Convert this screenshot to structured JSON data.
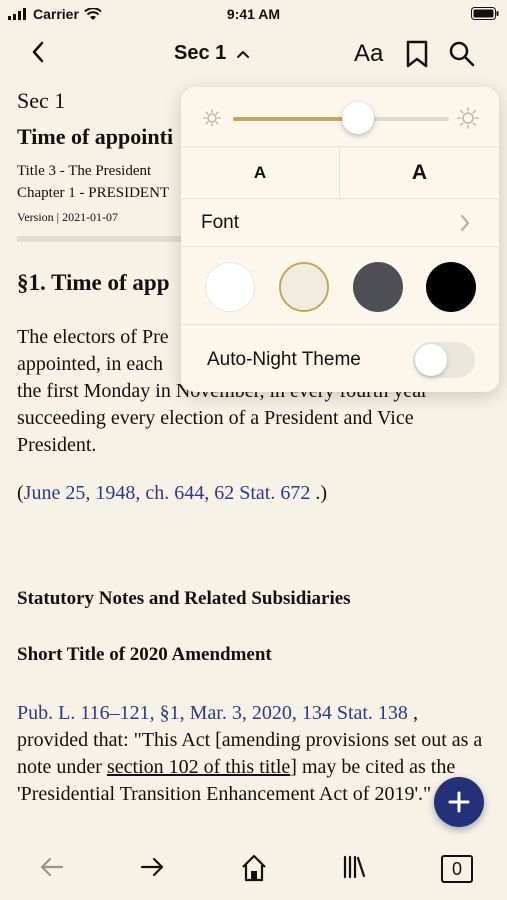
{
  "status_bar": {
    "carrier": "Carrier",
    "time": "9:41 AM"
  },
  "nav": {
    "section": "Sec 1",
    "text_size_label": "Aa"
  },
  "document": {
    "sec_label": "Sec 1",
    "title": "Time of appointi",
    "meta_line1": "Title 3 - The President",
    "meta_line2": "Chapter 1 - PRESIDENT",
    "version": "Version | 2021-01-07",
    "section_heading": "§1. Time of app",
    "paragraph_line1": "The electors of Pre",
    "paragraph_line2": "appointed, in each",
    "paragraph_line3": "the first Monday in November, in every fourth year",
    "paragraph_rest": "succeeding every election of a President and Vice President.",
    "citation_open": "(",
    "citation_link": "June 25, 1948, ch. 644, 62 Stat. 672",
    "citation_close": " .)",
    "notes_heading": "Statutory Notes and Related Subsidiaries",
    "short_title_heading": "Short Title of 2020 Amendment",
    "pub_link": "Pub. L. 116–121, §1, Mar. 3, 2020, 134 Stat. 138",
    "pub_text1": " , provided that: \"This Act [amending provisions set out as a note under ",
    "pub_underline": "section 102 of this title",
    "pub_text2": "] may be cited as the 'Presidential Transition Enhancement Act of 2019'.\""
  },
  "popover": {
    "brightness": 0.58,
    "size_small_label": "A",
    "size_large_label": "A",
    "font_label": "Font",
    "themes": [
      {
        "name": "white",
        "color": "#ffffff",
        "selected": false
      },
      {
        "name": "sepia",
        "color": "#f2ece0",
        "selected": true
      },
      {
        "name": "gray",
        "color": "#4d4f55",
        "selected": false
      },
      {
        "name": "black",
        "color": "#000000",
        "selected": false
      }
    ],
    "auto_night_label": "Auto-Night Theme",
    "auto_night_on": false
  },
  "toolbar": {
    "tab_count": "0"
  },
  "colors": {
    "accent": "#22327a",
    "link": "#2b3a8c",
    "slider_fill": "#c6a75a",
    "background": "#f7f2e6"
  }
}
